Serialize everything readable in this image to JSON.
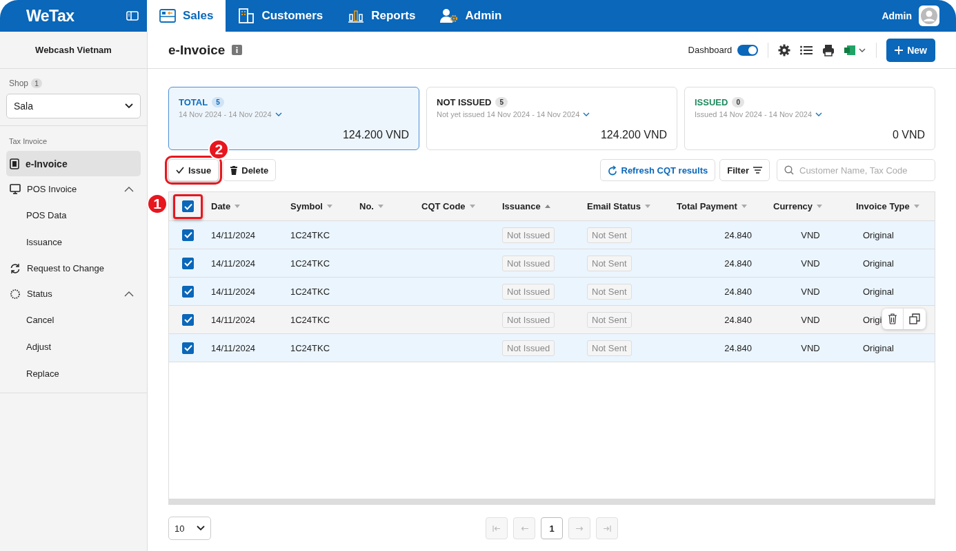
{
  "topbar": {
    "logo": "WeTax",
    "tabs": [
      {
        "label": "Sales",
        "selected": true
      },
      {
        "label": "Customers",
        "selected": false
      },
      {
        "label": "Reports",
        "selected": false
      },
      {
        "label": "Admin",
        "selected": false
      }
    ],
    "user": "Admin"
  },
  "sidebar": {
    "company": "Webcash Vietnam",
    "shop_label": "Shop",
    "shop_count": "1",
    "shop_value": "Sala",
    "section": "Tax Invoice",
    "items": [
      {
        "label": "e-Invoice",
        "selected": true
      },
      {
        "label": "POS Invoice",
        "selected": false,
        "expanded": true,
        "children": [
          {
            "label": "POS Data",
            "selected": false
          },
          {
            "label": "Issuance",
            "selected": false
          }
        ]
      },
      {
        "label": "Request to Change",
        "selected": false
      },
      {
        "label": "Status",
        "selected": false,
        "expanded": true,
        "children": [
          {
            "label": "Cancel",
            "selected": false
          },
          {
            "label": "Adjust",
            "selected": false
          },
          {
            "label": "Replace",
            "selected": false
          }
        ]
      }
    ]
  },
  "page": {
    "title": "e-Invoice",
    "dashboard_label": "Dashboard",
    "dashboard_on": true,
    "new_button": "New"
  },
  "cards": [
    {
      "title": "TOTAL",
      "count": "5",
      "subtitle": "14 Nov 2024 - 14 Nov 2024",
      "amount": "124.200 VND",
      "selected": true,
      "color": "#0a6ebd"
    },
    {
      "title": "NOT ISSUED",
      "count": "5",
      "subtitle": "Not yet issued 14 Nov 2024 - 14 Nov 2024",
      "amount": "124.200 VND",
      "selected": false,
      "color": "#222222"
    },
    {
      "title": "ISSUED",
      "count": "0",
      "subtitle": "Issued 14 Nov 2024 - 14 Nov 2024",
      "amount": "0 VND",
      "selected": false,
      "color": "#1e8a5e"
    }
  ],
  "toolbar": {
    "issue": {
      "label": "Issue",
      "callout": "2"
    },
    "delete": "Delete",
    "refresh": "Refresh CQT results",
    "filter": "Filter",
    "search": {
      "placeholder": "Customer Name, Tax Code"
    }
  },
  "table": {
    "select_all": {
      "checked": true,
      "callout": "1"
    },
    "columns": [
      {
        "label": "Date",
        "sorted_ascending": false
      },
      {
        "label": "Symbol",
        "sorted_ascending": false
      },
      {
        "label": "No.",
        "sorted_ascending": false
      },
      {
        "label": "CQT Code",
        "sorted_ascending": false
      },
      {
        "label": "Issuance",
        "sorted_ascending": true
      },
      {
        "label": "Email Status",
        "sorted_ascending": false
      },
      {
        "label": "Total Payment",
        "sorted_ascending": false
      },
      {
        "label": "Currency",
        "sorted_ascending": false
      },
      {
        "label": "Invoice Type",
        "sorted_ascending": false
      }
    ],
    "rows": [
      {
        "selected": true,
        "hovered": false,
        "date": "14/11/2024",
        "symbol": "1C24TKC",
        "issuance": "Not Issued",
        "email_status": "Not Sent",
        "total": "24.840",
        "currency": "VND",
        "invoice_type": "Original"
      },
      {
        "selected": true,
        "hovered": false,
        "date": "14/11/2024",
        "symbol": "1C24TKC",
        "issuance": "Not Issued",
        "email_status": "Not Sent",
        "total": "24.840",
        "currency": "VND",
        "invoice_type": "Original"
      },
      {
        "selected": true,
        "hovered": false,
        "date": "14/11/2024",
        "symbol": "1C24TKC",
        "issuance": "Not Issued",
        "email_status": "Not Sent",
        "total": "24.840",
        "currency": "VND",
        "invoice_type": "Original"
      },
      {
        "selected": true,
        "hovered": true,
        "date": "14/11/2024",
        "symbol": "1C24TKC",
        "issuance": "Not Issued",
        "email_status": "Not Sent",
        "total": "24.840",
        "currency": "VND",
        "invoice_type": "Origi"
      },
      {
        "selected": true,
        "hovered": false,
        "date": "14/11/2024",
        "symbol": "1C24TKC",
        "issuance": "Not Issued",
        "email_status": "Not Sent",
        "total": "24.840",
        "currency": "VND",
        "invoice_type": "Original"
      }
    ]
  },
  "pagination": {
    "page_size": "10",
    "pages": [
      {
        "label": "1",
        "selected": true
      }
    ]
  }
}
